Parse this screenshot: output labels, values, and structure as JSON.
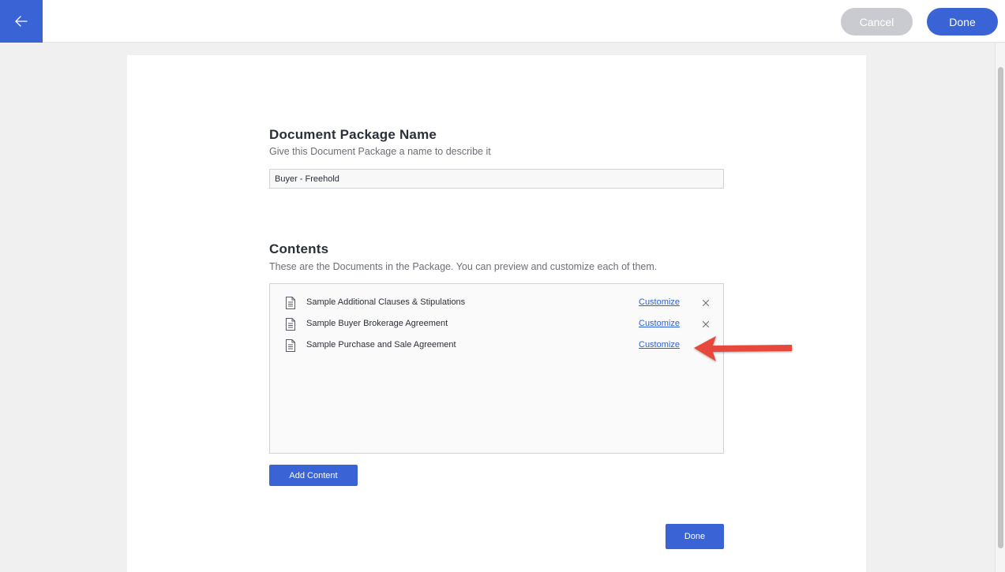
{
  "header": {
    "back_icon": "arrow-left-icon",
    "cancel_label": "Cancel",
    "done_label": "Done"
  },
  "name_section": {
    "title": "Document Package Name",
    "description": "Give this Document Package a name to describe it",
    "input_value": "Buyer - Freehold"
  },
  "contents_section": {
    "title": "Contents",
    "description": "These are the Documents in the Package. You can preview and customize each of them.",
    "items": [
      {
        "icon": "document-icon",
        "label": "Sample Additional Clauses & Stipulations",
        "customize_label": "Customize",
        "removable": true
      },
      {
        "icon": "document-icon",
        "label": "Sample Buyer Brokerage Agreement",
        "customize_label": "Customize",
        "removable": true
      },
      {
        "icon": "document-icon",
        "label": "Sample Purchase and Sale Agreement",
        "customize_label": "Customize",
        "removable": false
      }
    ],
    "add_content_label": "Add Content"
  },
  "footer": {
    "done_label": "Done"
  },
  "colors": {
    "accent": "#3a63d6",
    "link": "#2c5fd6",
    "annotation_arrow": "#e8473a",
    "cancel_disabled": "#c9cbd0"
  }
}
